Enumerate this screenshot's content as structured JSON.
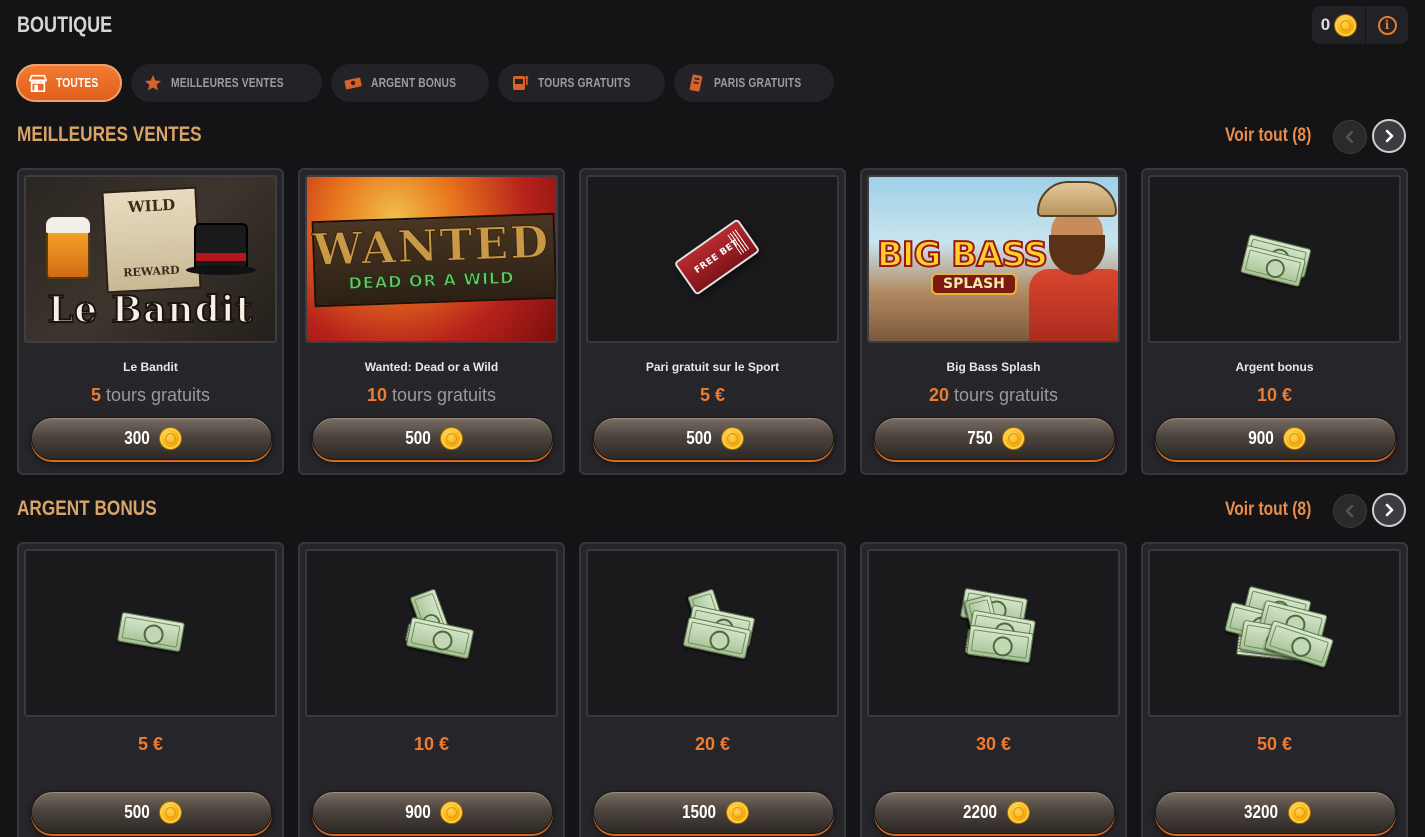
{
  "header": {
    "title": "BOUTIQUE",
    "balance": "0"
  },
  "tabs": [
    {
      "label": "TOUTES",
      "icon": "store-icon",
      "active": true
    },
    {
      "label": "MEILLEURES VENTES",
      "icon": "star-icon",
      "active": false
    },
    {
      "label": "ARGENT BONUS",
      "icon": "cash-icon",
      "active": false
    },
    {
      "label": "TOURS GRATUITS",
      "icon": "slot-machine-icon",
      "active": false
    },
    {
      "label": "PARIS GRATUITS",
      "icon": "ticket-icon",
      "active": false
    }
  ],
  "sections": {
    "best": {
      "title": "MEILLEURES VENTES",
      "see_all": "Voir tout (8)",
      "items": [
        {
          "name": "Le Bandit",
          "reward_value": "5",
          "reward_unit": "tours gratuits",
          "price": "300",
          "art": "Le Bandit",
          "art_top": "WILD",
          "art_mid": "REWARD"
        },
        {
          "name": "Wanted: Dead or a Wild",
          "reward_value": "10",
          "reward_unit": "tours gratuits",
          "price": "500",
          "art": "WANTED",
          "art_sub": "DEAD OR A WILD"
        },
        {
          "name": "Pari gratuit sur le Sport",
          "reward": "5 €",
          "price": "500",
          "art": "FREE BET"
        },
        {
          "name": "Big Bass Splash",
          "reward_value": "20",
          "reward_unit": "tours gratuits",
          "price": "750",
          "art": "BIG BASS",
          "art_sub": "SPLASH"
        },
        {
          "name": "Argent bonus",
          "reward": "10 €",
          "price": "900"
        }
      ]
    },
    "bonus": {
      "title": "ARGENT BONUS",
      "see_all": "Voir tout (8)",
      "items": [
        {
          "reward": "5 €",
          "price": "500"
        },
        {
          "reward": "10 €",
          "price": "900"
        },
        {
          "reward": "20 €",
          "price": "1500"
        },
        {
          "reward": "30 €",
          "price": "2200"
        },
        {
          "reward": "50 €",
          "price": "3200"
        }
      ]
    }
  },
  "colors": {
    "accent": "#ee7b33",
    "section_title": "#d9a467",
    "background": "#141416"
  }
}
